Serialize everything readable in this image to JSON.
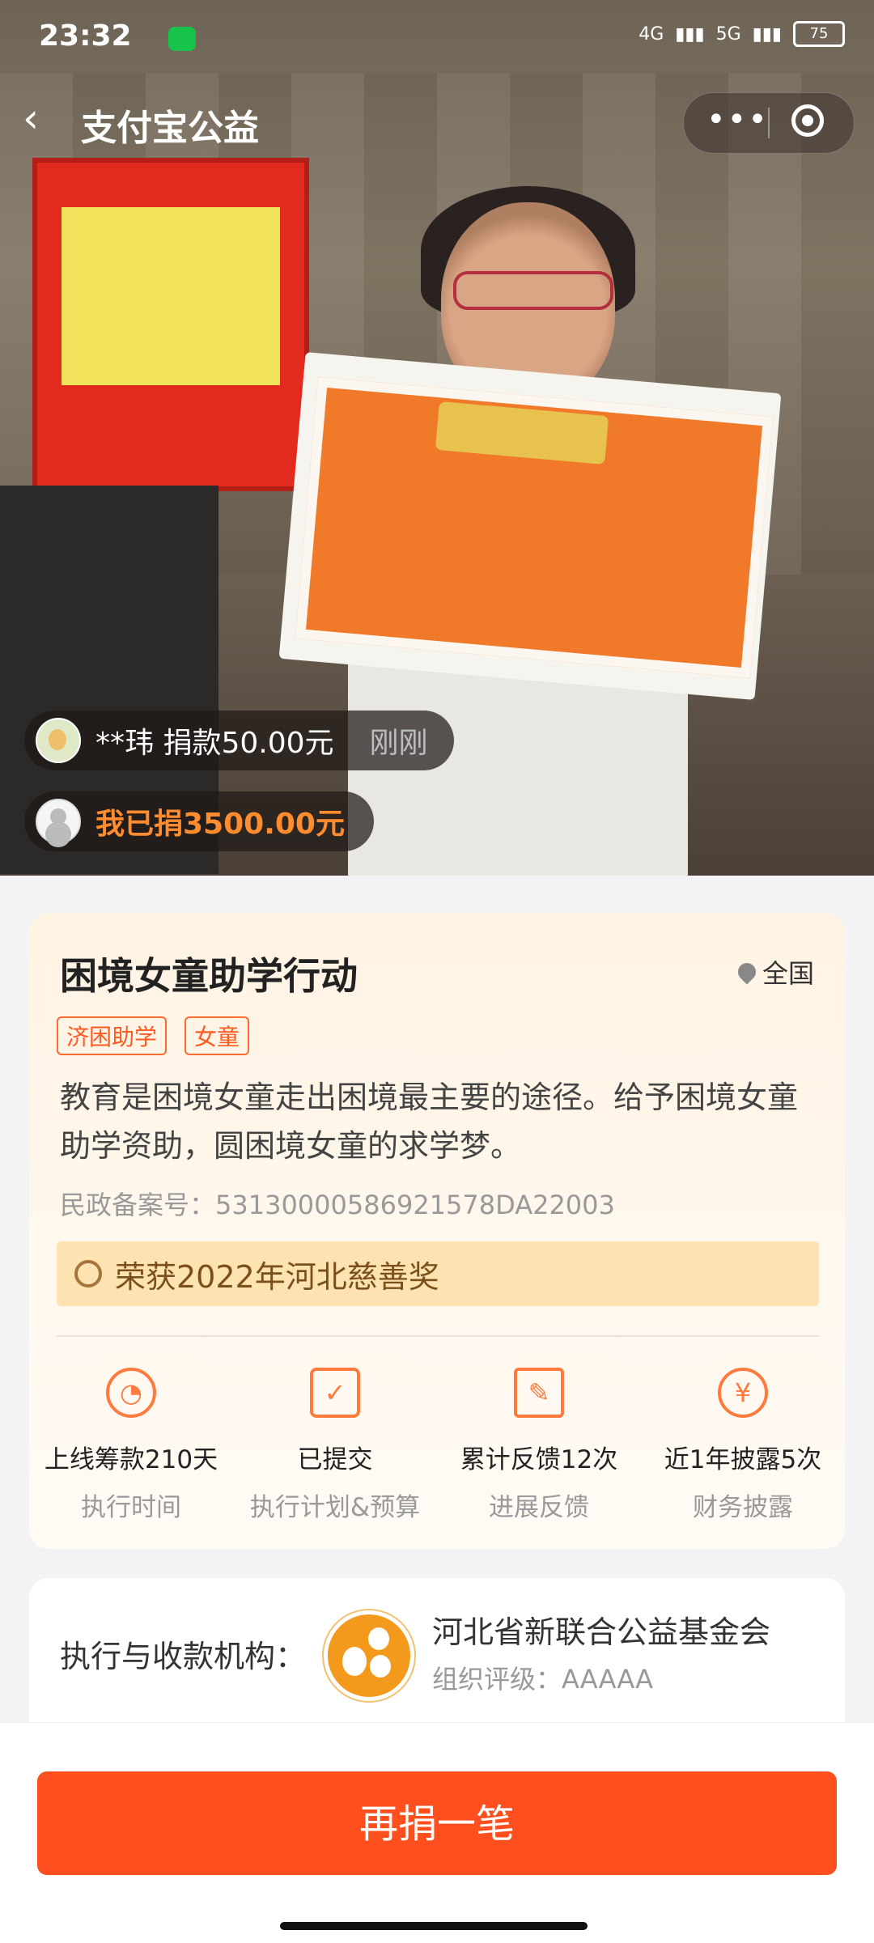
{
  "status_bar": {
    "time": "23:32",
    "network1": "4G",
    "network2": "5G",
    "battery": "75"
  },
  "nav": {
    "title": "支付宝公益",
    "more_icon": "more-dots-icon",
    "close_icon": "target-circle-icon"
  },
  "hero": {
    "ticker": {
      "name": "**玮 捐款50.00元",
      "time": "刚刚"
    },
    "my_donation": "我已捐3500.00元"
  },
  "project": {
    "title": "困境女童助学行动",
    "location": "全国",
    "tags": [
      "济困助学",
      "女童"
    ],
    "description": "教育是困境女童走出困境最主要的途径。给予困境女童助学资助，圆困境女童的求学梦。",
    "record": "民政备案号：53130000586921578DA22003",
    "award": "荣获2022年河北慈善奖",
    "stats": [
      {
        "icon": "clock-icon",
        "value": "上线筹款210天",
        "label": "执行时间"
      },
      {
        "icon": "calendar-check-icon",
        "value": "已提交",
        "label": "执行计划&预算"
      },
      {
        "icon": "edit-note-icon",
        "value": "累计反馈12次",
        "label": "进展反馈"
      },
      {
        "icon": "yen-icon",
        "value": "近1年披露5次",
        "label": "财务披露"
      }
    ]
  },
  "organization": {
    "label": "执行与收款机构：",
    "name": "河北省新联合公益基金会",
    "rating": "组织评级：AAAAA"
  },
  "cta": {
    "label": "再捐一笔"
  },
  "colors": {
    "accent": "#ff4f1e",
    "tag": "#ff5a1f",
    "award_bg": "#fde3b1"
  }
}
